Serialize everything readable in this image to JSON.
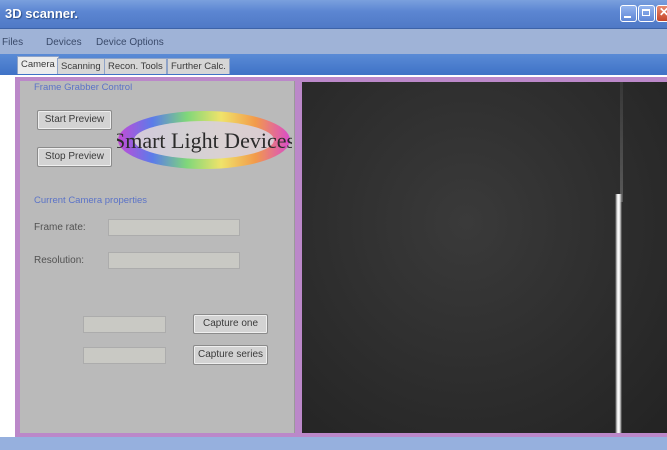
{
  "window": {
    "title": "3D scanner."
  },
  "menu": {
    "items": [
      "Files",
      "Devices",
      "Device Options"
    ]
  },
  "tabs": [
    {
      "label": "Camera",
      "active": true
    },
    {
      "label": "Scanning",
      "active": false
    },
    {
      "label": "Recon. Tools",
      "active": false
    },
    {
      "label": "Further Calc.",
      "active": false
    }
  ],
  "frame_grabber": {
    "group_label": "Frame Grabber Control",
    "start_preview": "Start Preview",
    "stop_preview": "Stop Preview"
  },
  "logo": {
    "text": "Smart Light Devices"
  },
  "camera_properties": {
    "group_label": "Current Camera properties",
    "frame_rate_label": "Frame rate:",
    "frame_rate_value": "",
    "resolution_label": "Resolution:",
    "resolution_value": ""
  },
  "capture": {
    "capture_one": "Capture one",
    "capture_one_field": "",
    "capture_series": "Capture series",
    "capture_series_field": ""
  },
  "colors": {
    "titlebar": "#5c86d2",
    "panel_border": "#bb88c9",
    "group_label": "#5b73c7",
    "preview_bg": "#2c2c2c"
  }
}
